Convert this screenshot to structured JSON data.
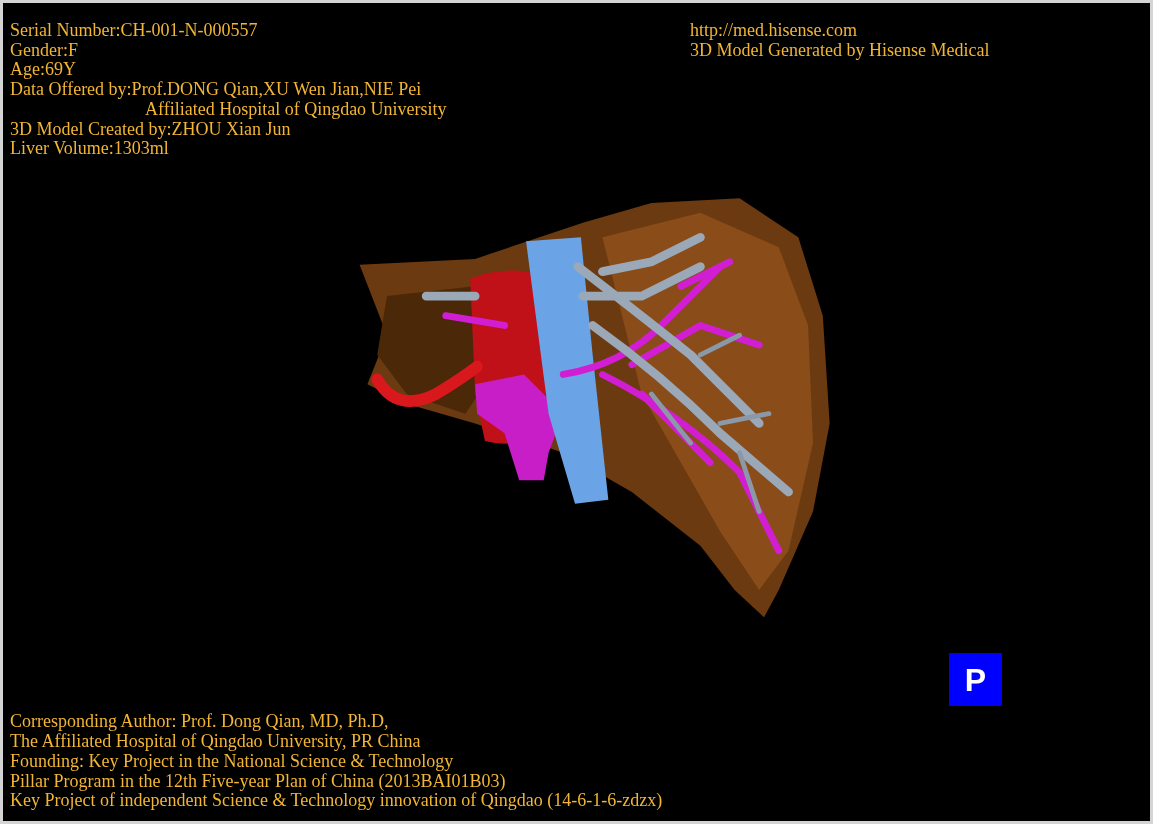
{
  "header_left": [
    {
      "text": "Serial Number:CH-001-N-000557",
      "indented": false
    },
    {
      "text": "Gender:F",
      "indented": false
    },
    {
      "text": "Age:69Y",
      "indented": false
    },
    {
      "text": "Data Offered by:Prof.DONG Qian,XU Wen Jian,NIE Pei",
      "indented": false
    },
    {
      "text": "Affiliated Hospital of Qingdao University",
      "indented": true
    },
    {
      "text": "3D Model Created by:ZHOU Xian Jun",
      "indented": false
    },
    {
      "text": "Liver Volume:1303ml",
      "indented": false
    }
  ],
  "header_right": [
    {
      "text": "http://med.hisense.com"
    },
    {
      "text": "3D Model Generated by Hisense Medical"
    }
  ],
  "badge": "P",
  "footer": [
    {
      "text": "Corresponding Author: Prof. Dong Qian, MD, Ph.D,"
    },
    {
      "text": "The Affiliated Hospital of Qingdao University, PR China"
    },
    {
      "text": "Founding: Key Project in the National Science & Technology"
    },
    {
      "text": "Pillar Program in the 12th Five-year Plan of China (2013BAI01B03)"
    },
    {
      "text": "Key Project of independent Science & Technology innovation of Qingdao (14-6-1-6-zdzx)"
    }
  ]
}
